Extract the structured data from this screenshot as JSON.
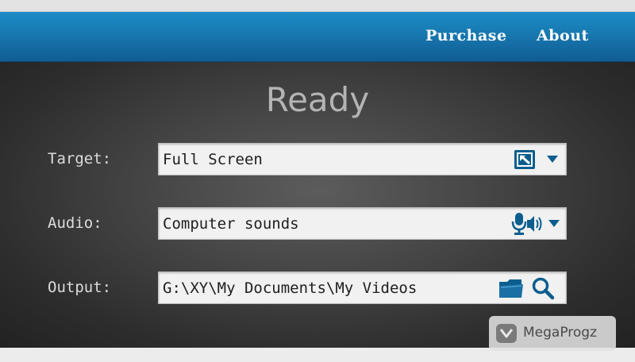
{
  "header": {
    "purchase_label": "Purchase",
    "about_label": "About"
  },
  "status": {
    "title": "Ready"
  },
  "target": {
    "label": "Target:",
    "value": "Full Screen",
    "icon": "select-region-icon"
  },
  "audio": {
    "label": "Audio:",
    "value": "Computer sounds",
    "icon": "microphone-speaker-icon"
  },
  "output": {
    "label": "Output:",
    "value": "G:\\XY\\My Documents\\My Videos",
    "icons": [
      "folder-icon",
      "search-icon"
    ]
  },
  "watermark": {
    "text": "MegaProgz"
  },
  "colors": {
    "header_blue": "#1878b0",
    "icon_blue": "#0b5e8e",
    "field_bg": "#f1f1f1",
    "status_text": "#b4b4b4"
  }
}
